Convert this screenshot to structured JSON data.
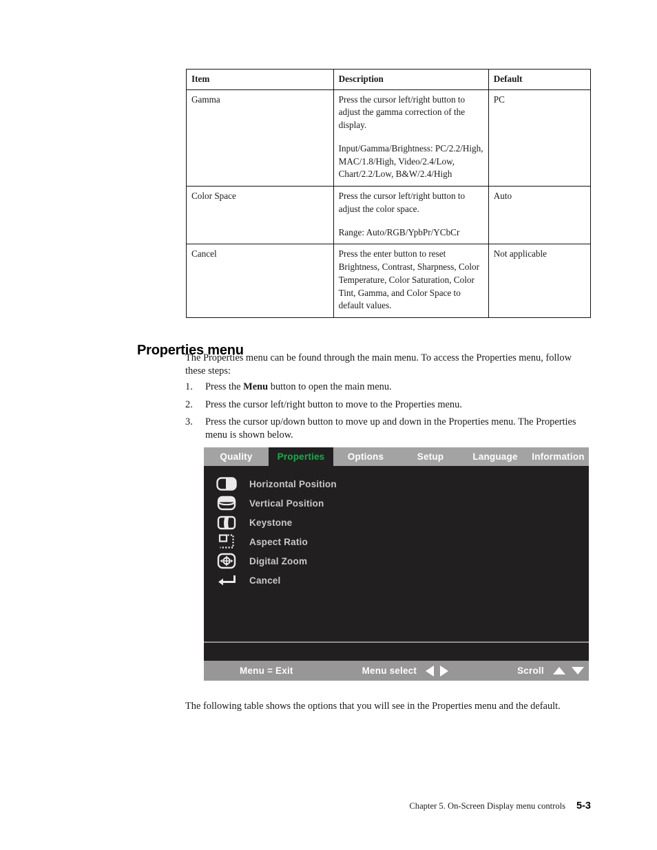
{
  "table": {
    "headers": [
      "Item",
      "Description",
      "Default"
    ],
    "rows": [
      {
        "item": "Gamma",
        "description": [
          "Press the cursor left/right button to adjust the gamma correction of the display.",
          "Input/Gamma/Brightness: PC/2.2/High, MAC/1.8/High, Video/2.4/Low, Chart/2.2/Low, B&W/2.4/High"
        ],
        "default": "PC"
      },
      {
        "item": "Color Space",
        "description": [
          "Press the cursor left/right button to adjust the color space.",
          "Range: Auto/RGB/YpbPr/YCbCr"
        ],
        "default": "Auto"
      },
      {
        "item": "Cancel",
        "description": [
          "Press the enter button to reset Brightness, Contrast, Sharpness, Color Temperature, Color Saturation, Color Tint, Gamma, and Color Space to default values."
        ],
        "default": "Not applicable"
      }
    ]
  },
  "section": {
    "heading": "Properties menu",
    "intro": "The Properties menu can be found through the main menu. To access the Properties menu, follow these steps:",
    "steps": [
      {
        "num": "1.",
        "pre": "Press the ",
        "bold": "Menu",
        "post": " button to open the main menu."
      },
      {
        "num": "2.",
        "pre": "Press the cursor left/right button to move to the Properties menu.",
        "bold": "",
        "post": ""
      },
      {
        "num": "3.",
        "pre": "Press the cursor up/down button to move up and down in the Properties menu. The Properties menu is shown below.",
        "bold": "",
        "post": ""
      }
    ],
    "outro": "The following table shows the options that you will see in the Properties menu and the default."
  },
  "osd": {
    "tabs": [
      {
        "label": "Quality",
        "active": false
      },
      {
        "label": "Properties",
        "active": true
      },
      {
        "label": "Options",
        "active": false
      },
      {
        "label": "Setup",
        "active": false
      },
      {
        "label": "Language",
        "active": false
      },
      {
        "label": "Information",
        "active": false
      }
    ],
    "active_tab_color": "#12b14a",
    "tabbar_color": "#a3a3a3",
    "panel_color": "#211f1f",
    "footer_color": "#979797",
    "items": [
      {
        "label": "Horizontal Position",
        "icon": "horizontal-position-icon"
      },
      {
        "label": "Vertical Position",
        "icon": "vertical-position-icon"
      },
      {
        "label": "Keystone",
        "icon": "keystone-icon"
      },
      {
        "label": "Aspect Ratio",
        "icon": "aspect-ratio-icon"
      },
      {
        "label": "Digital Zoom",
        "icon": "digital-zoom-icon"
      },
      {
        "label": "Cancel",
        "icon": "enter-return-icon"
      }
    ],
    "footer": {
      "exit": "Menu = Exit",
      "select": "Menu select",
      "scroll": "Scroll"
    }
  },
  "page_footer": {
    "chapter": "Chapter 5. On-Screen Display menu controls",
    "page": "5-3"
  }
}
